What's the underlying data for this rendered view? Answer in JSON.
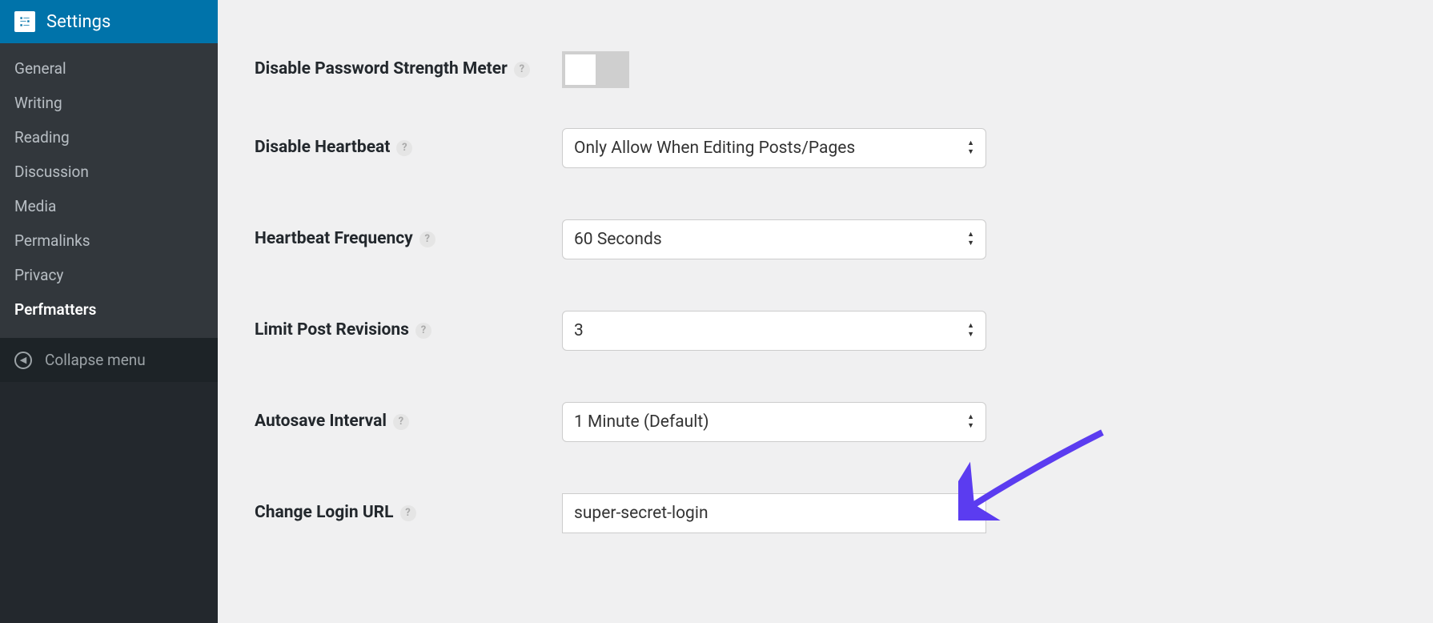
{
  "sidebar": {
    "header_label": "Settings",
    "items": [
      {
        "label": "General"
      },
      {
        "label": "Writing"
      },
      {
        "label": "Reading"
      },
      {
        "label": "Discussion"
      },
      {
        "label": "Media"
      },
      {
        "label": "Permalinks"
      },
      {
        "label": "Privacy"
      },
      {
        "label": "Perfmatters"
      }
    ],
    "collapse_label": "Collapse menu"
  },
  "form": {
    "disable_password_strength": {
      "label": "Disable Password Strength Meter"
    },
    "disable_heartbeat": {
      "label": "Disable Heartbeat",
      "value": "Only Allow When Editing Posts/Pages"
    },
    "heartbeat_frequency": {
      "label": "Heartbeat Frequency",
      "value": "60 Seconds"
    },
    "limit_post_revisions": {
      "label": "Limit Post Revisions",
      "value": "3"
    },
    "autosave_interval": {
      "label": "Autosave Interval",
      "value": "1 Minute (Default)"
    },
    "change_login_url": {
      "label": "Change Login URL",
      "value": "super-secret-login"
    }
  }
}
